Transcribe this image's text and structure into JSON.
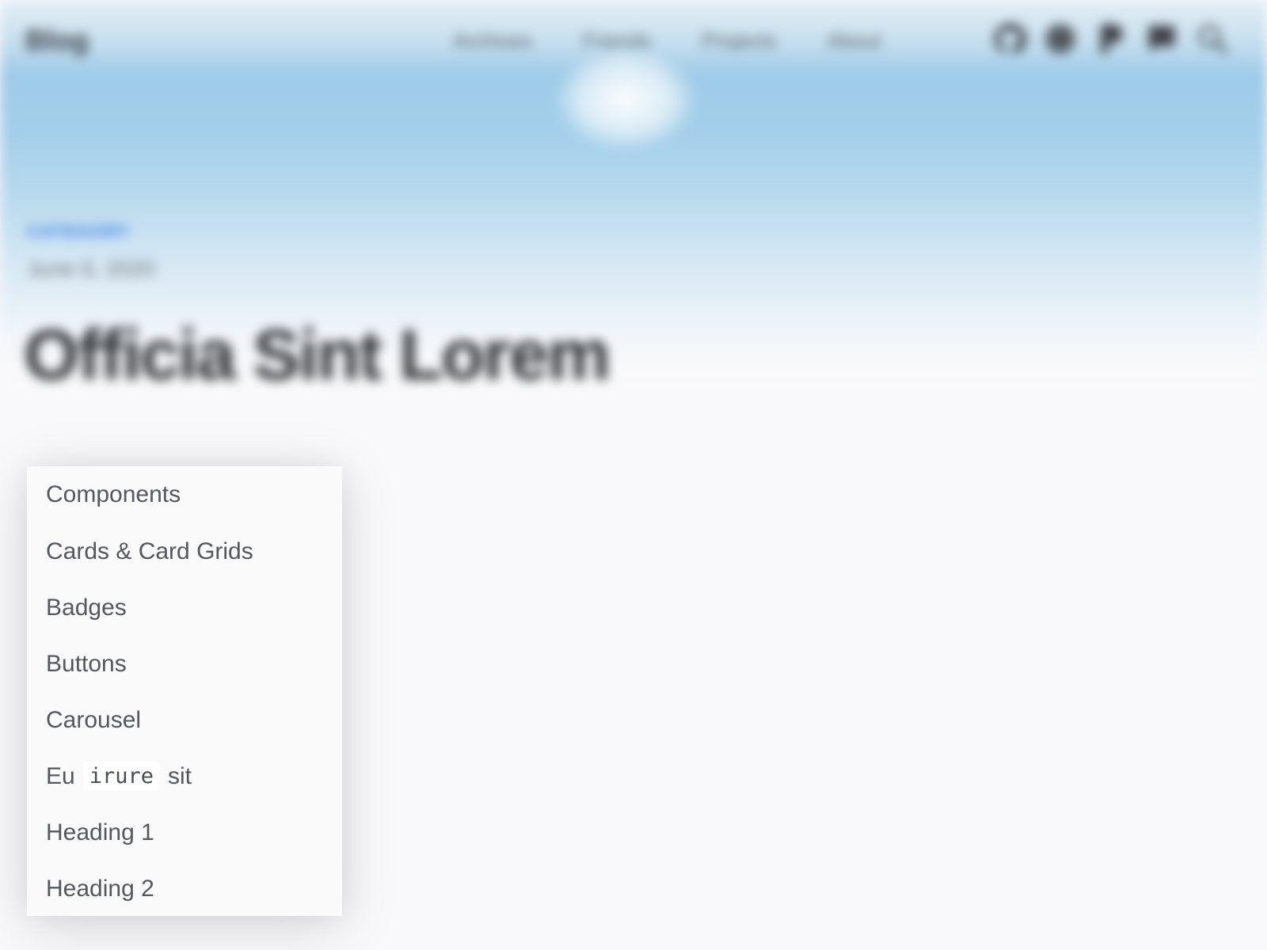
{
  "header": {
    "brand": "Blog",
    "nav_links": [
      "Archives",
      "Friends",
      "Projects",
      "About"
    ],
    "icons": [
      "github-icon",
      "globe-icon",
      "pixiv-icon",
      "chat-icon",
      "search-icon"
    ]
  },
  "post": {
    "category": "CATEGORY",
    "date": "June 6, 2020",
    "title": "Officia Sint Lorem"
  },
  "toc": {
    "items": [
      {
        "label": "Components"
      },
      {
        "label": "Cards & Card Grids"
      },
      {
        "label": "Badges"
      },
      {
        "label": "Buttons"
      },
      {
        "label": "Carousel"
      },
      {
        "prefix": "Eu",
        "code": "irure",
        "suffix": "sit"
      },
      {
        "label": "Heading 1"
      },
      {
        "label": "Heading 2"
      }
    ]
  }
}
